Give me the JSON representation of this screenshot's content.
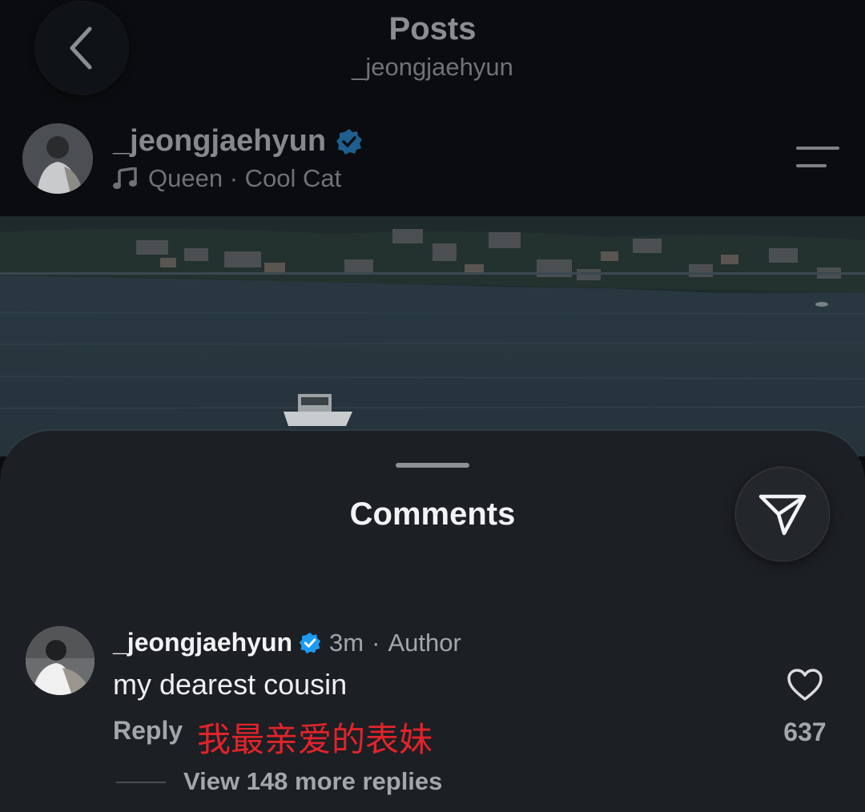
{
  "header": {
    "title": "Posts",
    "subtitle": "_jeongjaehyun"
  },
  "post": {
    "username": "_jeongjaehyun",
    "verified": true,
    "music": "Queen · Cool Cat",
    "music_icon": "music-note-icon"
  },
  "sheet": {
    "title": "Comments"
  },
  "comment": {
    "username": "_jeongjaehyun",
    "verified": true,
    "time": "3m",
    "separator": "·",
    "role": "Author",
    "text": "my dearest cousin",
    "reply_label": "Reply",
    "translation": "我最亲爱的表妹",
    "like_count": "637",
    "view_replies": "View 148 more replies"
  },
  "colors": {
    "verified_blue": "#1d9bf0",
    "translation_red": "#e0242b",
    "sheet_bg": "#1c1f23"
  }
}
